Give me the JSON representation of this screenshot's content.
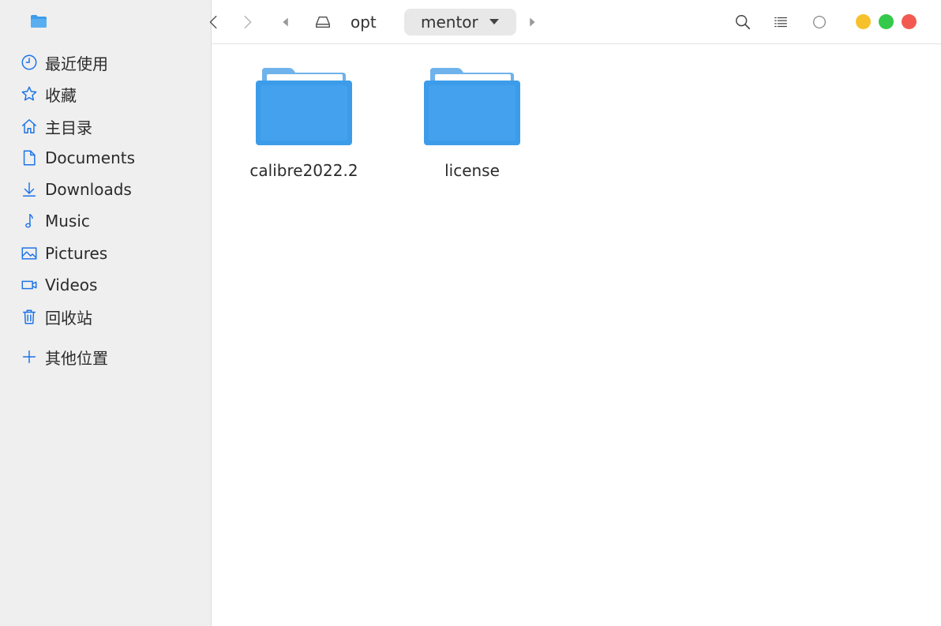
{
  "sidebar": {
    "items": [
      {
        "label": "最近使用",
        "icon": "clock-icon"
      },
      {
        "label": "收藏",
        "icon": "star-icon"
      },
      {
        "label": "主目录",
        "icon": "home-icon"
      },
      {
        "label": "Documents",
        "icon": "document-icon"
      },
      {
        "label": "Downloads",
        "icon": "download-icon"
      },
      {
        "label": "Music",
        "icon": "music-note-icon"
      },
      {
        "label": "Pictures",
        "icon": "picture-icon"
      },
      {
        "label": "Videos",
        "icon": "video-icon"
      },
      {
        "label": "回收站",
        "icon": "trash-icon"
      },
      {
        "label": "其他位置",
        "icon": "plus-icon"
      }
    ]
  },
  "toolbar": {
    "breadcrumbs": [
      "opt",
      "mentor"
    ]
  },
  "files": [
    {
      "name": "calibre2022.2",
      "type": "folder"
    },
    {
      "name": "license",
      "type": "folder"
    }
  ],
  "colors": {
    "accent": "#1a73e8",
    "folder_back": "#6fb3ec",
    "folder_front": "#3d9cea",
    "minimize": "#f6c12b",
    "maximize": "#34c94a",
    "close": "#f25a51"
  }
}
